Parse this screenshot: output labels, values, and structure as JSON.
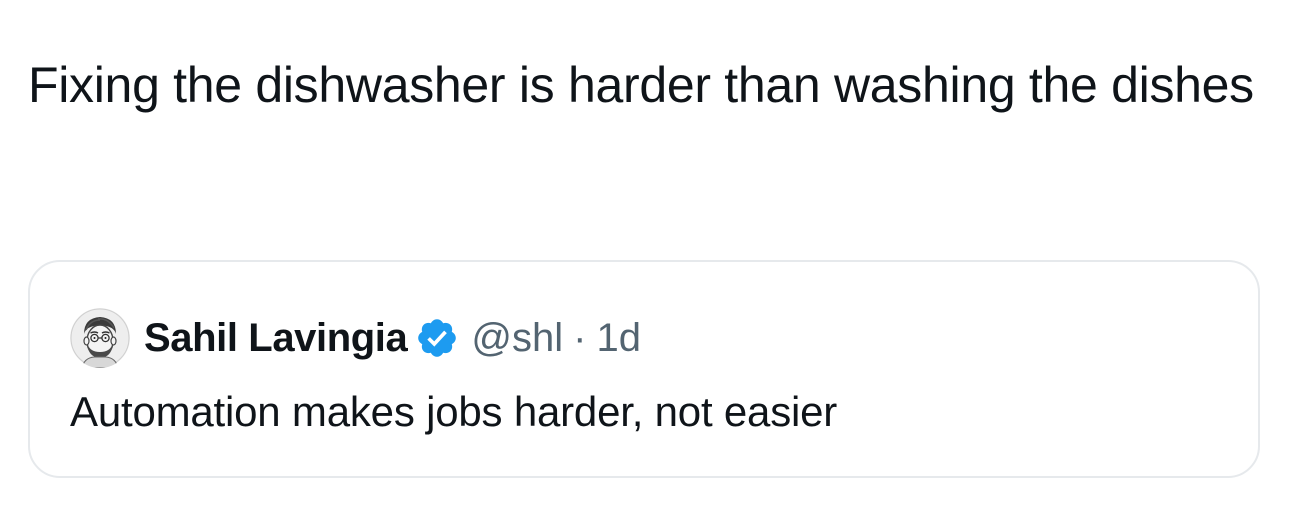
{
  "tweet": {
    "text": "Fixing the dishwasher is harder than washing the dishes"
  },
  "quoted_tweet": {
    "author_name": "Sahil Lavingia",
    "handle": "@shl",
    "separator": "·",
    "time": "1d",
    "text": "Automation makes jobs harder, not easier",
    "avatar_icon": "sketch-portrait-avatar",
    "verified_icon": "verified-badge-icon",
    "verified_color": "#1d9bf0"
  },
  "colors": {
    "text_primary": "#0f1419",
    "text_secondary": "#536471",
    "card_border": "#e6e9ec"
  }
}
